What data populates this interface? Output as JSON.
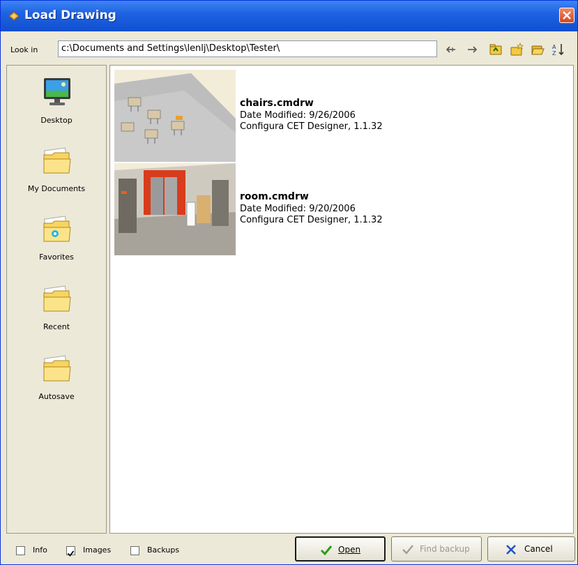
{
  "window": {
    "title": "Load Drawing"
  },
  "lookin": {
    "label": "Look in",
    "path": "c:\\Documents and Settings\\lenlj\\Desktop\\Tester\\"
  },
  "places": [
    {
      "label": "Desktop",
      "icon": "desktop-icon"
    },
    {
      "label": "My Documents",
      "icon": "folder-icon"
    },
    {
      "label": "Favorites",
      "icon": "favorites-folder-icon"
    },
    {
      "label": "Recent",
      "icon": "folder-icon"
    },
    {
      "label": "Autosave",
      "icon": "folder-icon"
    }
  ],
  "files": [
    {
      "name": "chairs.cmdrw",
      "date_modified": "Date Modified: 9/26/2006",
      "creator": "Configura CET Designer, 1.1.32"
    },
    {
      "name": "room.cmdrw",
      "date_modified": "Date Modified: 9/20/2006",
      "creator": "Configura CET Designer, 1.1.32"
    }
  ],
  "options": {
    "info": {
      "label": "Info",
      "checked": false
    },
    "images": {
      "label": "Images",
      "checked": true
    },
    "backups": {
      "label": "Backups",
      "checked": false
    }
  },
  "buttons": {
    "open": "Open",
    "find_backup": "Find backup",
    "cancel": "Cancel"
  },
  "colors": {
    "titlebar": "#1f63e2",
    "dialog_bg": "#ece9d8",
    "folder_yellow": "#f7d560",
    "accent_green": "#2e9a1a",
    "cancel_blue": "#2252c8"
  }
}
